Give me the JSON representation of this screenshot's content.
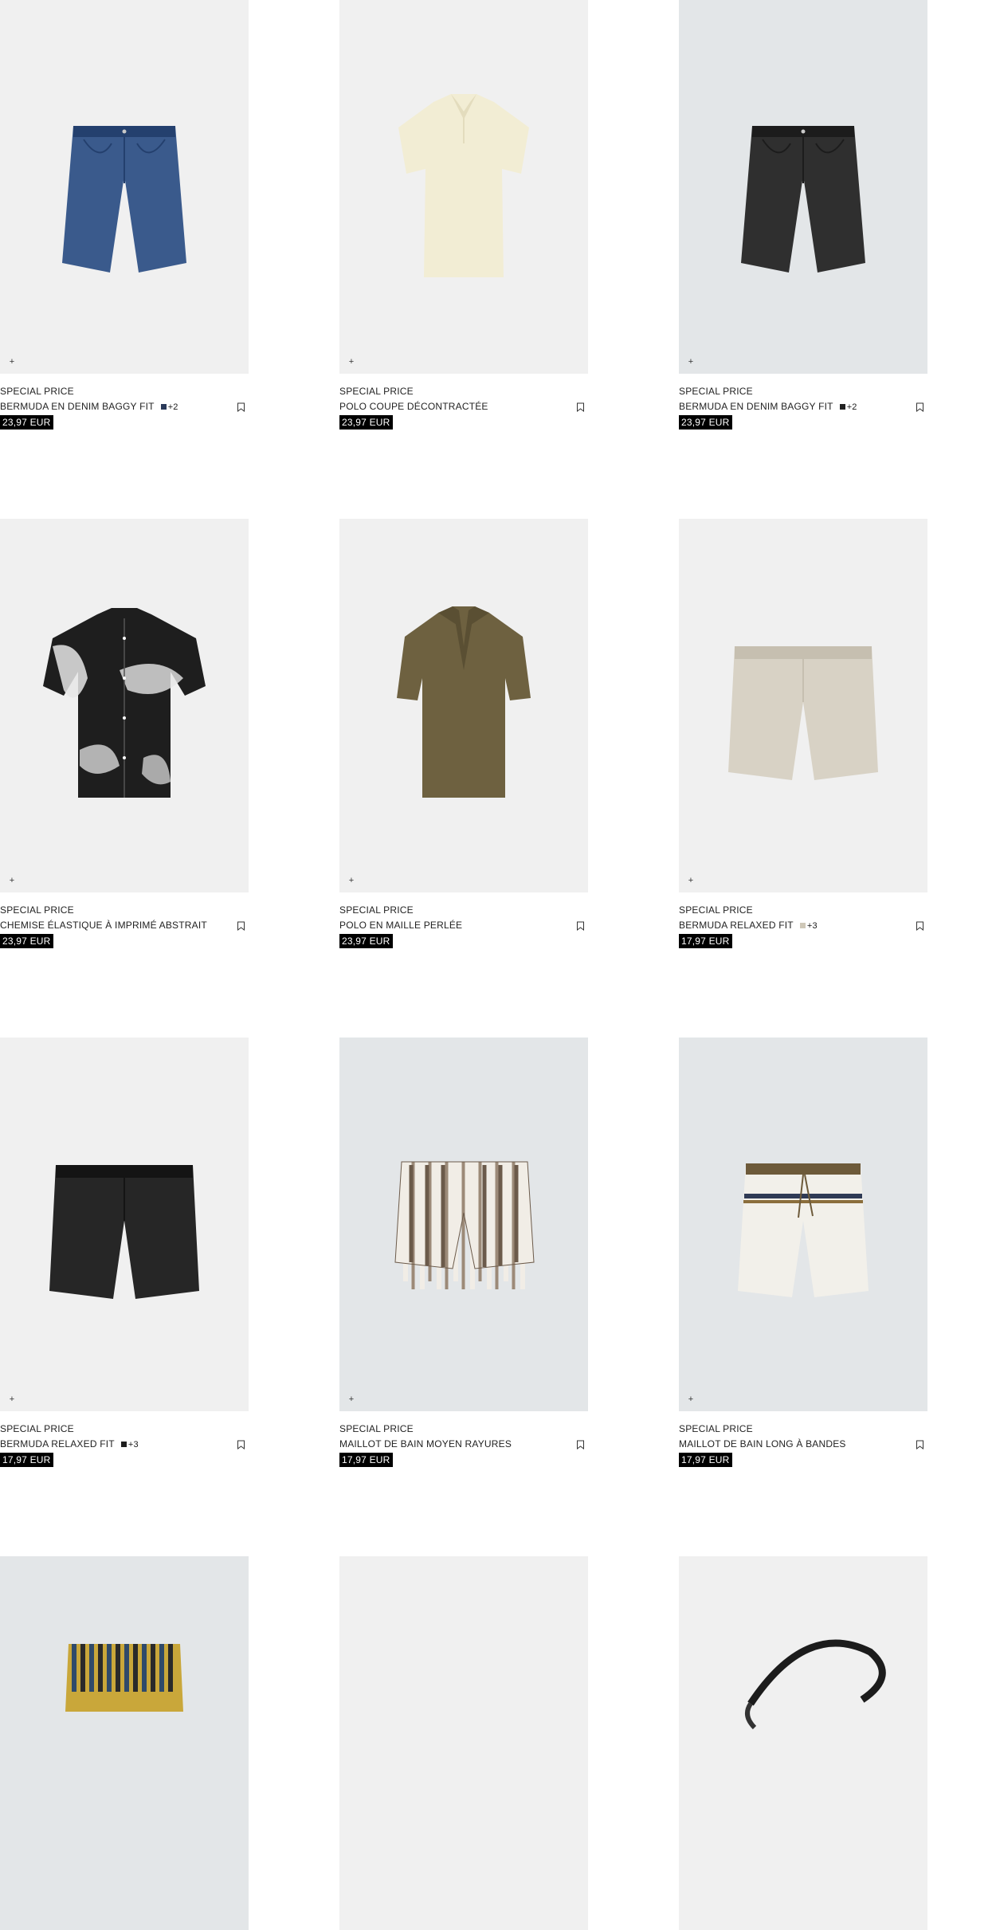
{
  "products": [
    {
      "promo": "SPECIAL PRICE",
      "name": "BERMUDA EN DENIM BAGGY FIT",
      "swatch_color": "#2b3a5a",
      "more_colors": "+2",
      "price": "23,97 EUR",
      "bg": "#f0f0f0",
      "quick_add": "+",
      "art": "denim-shorts",
      "color": "#3a5a8c",
      "accent": "#24406e"
    },
    {
      "promo": "SPECIAL PRICE",
      "name": "POLO COUPE DÉCONTRACTÉE",
      "swatch_color": "",
      "more_colors": "",
      "price": "23,97 EUR",
      "bg": "#f0f0f0",
      "quick_add": "+",
      "art": "polo",
      "color": "#f2edd4",
      "accent": "#e3dcbd"
    },
    {
      "promo": "SPECIAL PRICE",
      "name": "BERMUDA EN DENIM BAGGY FIT",
      "swatch_color": "#222222",
      "more_colors": "+2",
      "price": "23,97 EUR",
      "bg": "#e3e6e8",
      "quick_add": "+",
      "art": "denim-shorts",
      "color": "#2f2f2f",
      "accent": "#1c1c1c"
    },
    {
      "promo": "SPECIAL PRICE",
      "name": "CHEMISE ÉLASTIQUE À IMPRIMÉ ABSTRAIT",
      "swatch_color": "",
      "more_colors": "",
      "price": "23,97 EUR",
      "bg": "#f0f0f0",
      "quick_add": "+",
      "art": "printed-shirt",
      "color": "#1e1e1e",
      "accent": "#e6e6e6"
    },
    {
      "promo": "SPECIAL PRICE",
      "name": "POLO EN MAILLE PERLÉE",
      "swatch_color": "",
      "more_colors": "",
      "price": "23,97 EUR",
      "bg": "#f0f0f0",
      "quick_add": "+",
      "art": "knit-polo",
      "color": "#6e6140",
      "accent": "#5a4f33"
    },
    {
      "promo": "SPECIAL PRICE",
      "name": "BERMUDA RELAXED FIT",
      "swatch_color": "#cfc8b8",
      "more_colors": "+3",
      "price": "17,97 EUR",
      "bg": "#f0f0f0",
      "quick_add": "+",
      "art": "relaxed-shorts",
      "color": "#d8d2c5",
      "accent": "#c6bfb0"
    },
    {
      "promo": "SPECIAL PRICE",
      "name": "BERMUDA RELAXED FIT",
      "swatch_color": "#1e1e1e",
      "more_colors": "+3",
      "price": "17,97 EUR",
      "bg": "#f0f0f0",
      "quick_add": "+",
      "art": "relaxed-shorts",
      "color": "#262626",
      "accent": "#141414"
    },
    {
      "promo": "SPECIAL PRICE",
      "name": "MAILLOT DE BAIN MOYEN RAYURES",
      "swatch_color": "",
      "more_colors": "",
      "price": "17,97 EUR",
      "bg": "#e3e6e8",
      "quick_add": "+",
      "art": "striped-swim",
      "color": "#f1ede6",
      "accent": "#6b5a4a"
    },
    {
      "promo": "SPECIAL PRICE",
      "name": "MAILLOT DE BAIN LONG À BANDES",
      "swatch_color": "",
      "more_colors": "",
      "price": "17,97 EUR",
      "bg": "#e3e6e8",
      "quick_add": "+",
      "art": "band-swim",
      "color": "#f2f0ea",
      "accent": "#6d5a3a"
    },
    {
      "promo": "",
      "name": "",
      "swatch_color": "",
      "more_colors": "",
      "price": "",
      "bg": "#e3e6e8",
      "quick_add": "",
      "art": "yellow-swim",
      "color": "#c9a73a",
      "accent": "#2a2a2a"
    },
    {
      "promo": "",
      "name": "",
      "swatch_color": "",
      "more_colors": "",
      "price": "",
      "bg": "#f0f0f0",
      "quick_add": "",
      "art": "none",
      "color": "",
      "accent": ""
    },
    {
      "promo": "",
      "name": "",
      "swatch_color": "",
      "more_colors": "",
      "price": "",
      "bg": "#f0f0f0",
      "quick_add": "",
      "art": "strap-bag",
      "color": "#1c1c1c",
      "accent": "#333333"
    }
  ]
}
